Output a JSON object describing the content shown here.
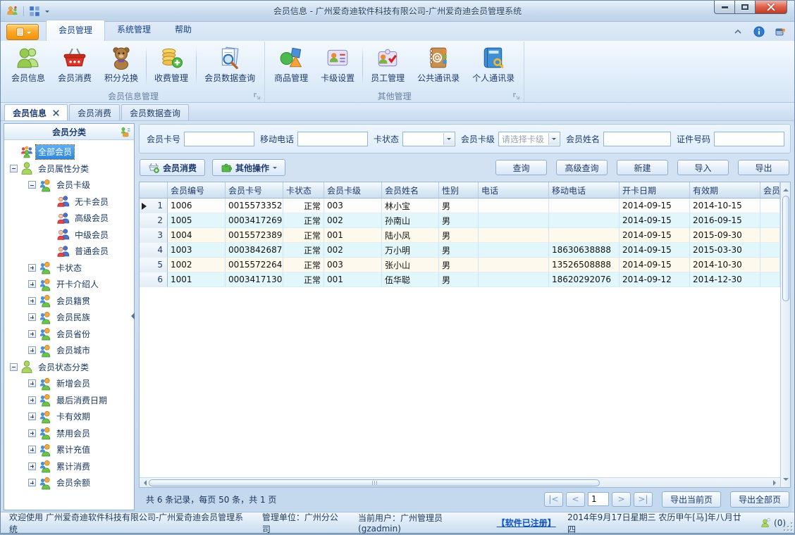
{
  "window": {
    "title": "会员信息 - 广州爱奇迪软件科技有限公司-广州爱奇迪会员管理系统"
  },
  "quick_access": {
    "icons": [
      "app-logo-icon",
      "layout-grid-icon"
    ]
  },
  "ribbon": {
    "tabs": [
      {
        "label": "会员管理",
        "active": true
      },
      {
        "label": "系统管理",
        "active": false
      },
      {
        "label": "帮助",
        "active": false
      }
    ],
    "right_icons": [
      "collapse-ribbon-icon",
      "info-icon",
      "feedback-icon"
    ],
    "groups": [
      {
        "label": "会员信息管理",
        "buttons": [
          {
            "label": "会员信息",
            "icon": "members-icon"
          },
          {
            "label": "会员消费",
            "icon": "basket-icon"
          },
          {
            "label": "积分兑换",
            "icon": "teddy-icon",
            "sep_after": true
          },
          {
            "label": "收费管理",
            "icon": "coins-icon",
            "sep_after": true
          },
          {
            "label": "会员数据查询",
            "icon": "doc-search-icon"
          }
        ]
      },
      {
        "label": "其他管理",
        "buttons": [
          {
            "label": "商品管理",
            "icon": "goods-icon"
          },
          {
            "label": "卡级设置",
            "icon": "card-level-icon",
            "sep_after": true
          },
          {
            "label": "员工管理",
            "icon": "employee-icon"
          },
          {
            "label": "公共通讯录",
            "icon": "public-contacts-icon"
          },
          {
            "label": "个人通讯录",
            "icon": "personal-contacts-icon"
          }
        ]
      }
    ]
  },
  "doc_tabs": [
    {
      "label": "会员信息",
      "active": true,
      "closable": true
    },
    {
      "label": "会员消费",
      "active": false
    },
    {
      "label": "会员数据查询",
      "active": false
    }
  ],
  "sidebar": {
    "title": "会员分类",
    "tree": [
      {
        "label": "全部会员",
        "level": 0,
        "icon": "crowd-icon",
        "selected": true
      },
      {
        "label": "会员属性分类",
        "level": 0,
        "toggle": "minus",
        "icon": "person-green-icon"
      },
      {
        "label": "会员卡级",
        "level": 1,
        "toggle": "minus",
        "icon": "duo-orange-icon"
      },
      {
        "label": "无卡会员",
        "level": 2,
        "icon": "duo-red-icon"
      },
      {
        "label": "高级会员",
        "level": 2,
        "icon": "duo-red-icon"
      },
      {
        "label": "中级会员",
        "level": 2,
        "icon": "duo-red-icon"
      },
      {
        "label": "普通会员",
        "level": 2,
        "icon": "duo-red-icon"
      },
      {
        "label": "卡状态",
        "level": 1,
        "toggle": "plus",
        "icon": "duo-orange-icon"
      },
      {
        "label": "开卡介绍人",
        "level": 1,
        "toggle": "plus",
        "icon": "duo-orange-icon"
      },
      {
        "label": "会员籍贯",
        "level": 1,
        "toggle": "plus",
        "icon": "duo-orange-icon"
      },
      {
        "label": "会员民族",
        "level": 1,
        "toggle": "plus",
        "icon": "duo-orange-icon"
      },
      {
        "label": "会员省份",
        "level": 1,
        "toggle": "plus",
        "icon": "duo-orange-icon"
      },
      {
        "label": "会员城市",
        "level": 1,
        "toggle": "plus",
        "icon": "duo-orange-icon"
      },
      {
        "label": "会员状态分类",
        "level": 0,
        "toggle": "minus",
        "icon": "person-green-icon"
      },
      {
        "label": "新增会员",
        "level": 1,
        "toggle": "plus",
        "icon": "duo-orange-icon"
      },
      {
        "label": "最后消费日期",
        "level": 1,
        "toggle": "plus",
        "icon": "duo-orange-icon"
      },
      {
        "label": "卡有效期",
        "level": 1,
        "toggle": "plus",
        "icon": "duo-orange-icon"
      },
      {
        "label": "禁用会员",
        "level": 1,
        "toggle": "plus",
        "icon": "duo-orange-icon"
      },
      {
        "label": "累计充值",
        "level": 1,
        "toggle": "plus",
        "icon": "duo-orange-icon"
      },
      {
        "label": "累计消费",
        "level": 1,
        "toggle": "plus",
        "icon": "duo-orange-icon"
      },
      {
        "label": "会员余额",
        "level": 1,
        "toggle": "plus",
        "icon": "duo-orange-icon"
      }
    ]
  },
  "filters": {
    "fields": [
      {
        "label": "会员卡号",
        "type": "text",
        "value": ""
      },
      {
        "label": "移动电话",
        "type": "text",
        "value": ""
      },
      {
        "label": "卡状态",
        "type": "select",
        "value": "",
        "is_placeholder": false
      },
      {
        "label": "会员卡级",
        "type": "select",
        "value": "请选择卡级",
        "is_placeholder": true
      },
      {
        "label": "会员姓名",
        "type": "text",
        "value": ""
      },
      {
        "label": "证件号码",
        "type": "text",
        "value": ""
      }
    ]
  },
  "toolbar": {
    "left": [
      {
        "label": "会员消费",
        "icon": "basket-add-icon"
      },
      {
        "label": "其他操作",
        "icon": "puzzle-icon",
        "dropdown": true
      }
    ],
    "right": [
      {
        "label": "查询"
      },
      {
        "label": "高级查询"
      },
      {
        "label": "新建"
      },
      {
        "label": "导入"
      },
      {
        "label": "导出"
      }
    ]
  },
  "grid": {
    "columns": [
      "",
      "会员编号",
      "会员卡号",
      "卡状态",
      "会员卡级",
      "会员姓名",
      "性别",
      "电话",
      "移动电话",
      "开卡日期",
      "有效期",
      "会员"
    ],
    "selected_row_index": 0,
    "rows": [
      [
        "1",
        "1006",
        "0015573352",
        "正常",
        "003",
        "林小宝",
        "男",
        "",
        "",
        "2014-09-15",
        "2014-10-15",
        ""
      ],
      [
        "2",
        "1005",
        "0003417269",
        "正常",
        "002",
        "孙南山",
        "男",
        "",
        "",
        "2014-09-15",
        "2016-09-15",
        ""
      ],
      [
        "3",
        "1004",
        "0015572389",
        "正常",
        "001",
        "陆小凤",
        "男",
        "",
        "",
        "2014-09-15",
        "2015-09-30",
        ""
      ],
      [
        "4",
        "1003",
        "0003842687",
        "正常",
        "002",
        "万小明",
        "男",
        "",
        "18630638888",
        "2014-09-15",
        "2015-03-30",
        ""
      ],
      [
        "5",
        "1002",
        "0015572264",
        "正常",
        "003",
        "张小山",
        "男",
        "",
        "13526508888",
        "2014-09-15",
        "2014-10-30",
        ""
      ],
      [
        "6",
        "1001",
        "0003417130",
        "正常",
        "001",
        "伍华聪",
        "男",
        "",
        "18620292076",
        "2014-09-12",
        "2014-12-30",
        ""
      ]
    ]
  },
  "pager": {
    "summary": "共 6 条记录，每页 50 条，共 1 页",
    "first": "|<",
    "prev": "<",
    "page": "1",
    "next": ">",
    "last": ">|",
    "export_current": "导出当前页",
    "export_all": "导出全部页"
  },
  "status_bar": {
    "welcome": "欢迎使用 广州爱奇迪软件科技有限公司-广州爱奇迪会员管理系统",
    "org": "管理单位：广州分公司",
    "user": "当前用户：广州管理员(gzadmin)",
    "registered": "【软件已注册】",
    "datetime": "2014年9月17日星期三 农历甲午[马]年八月廿四",
    "messages": "(0)"
  }
}
